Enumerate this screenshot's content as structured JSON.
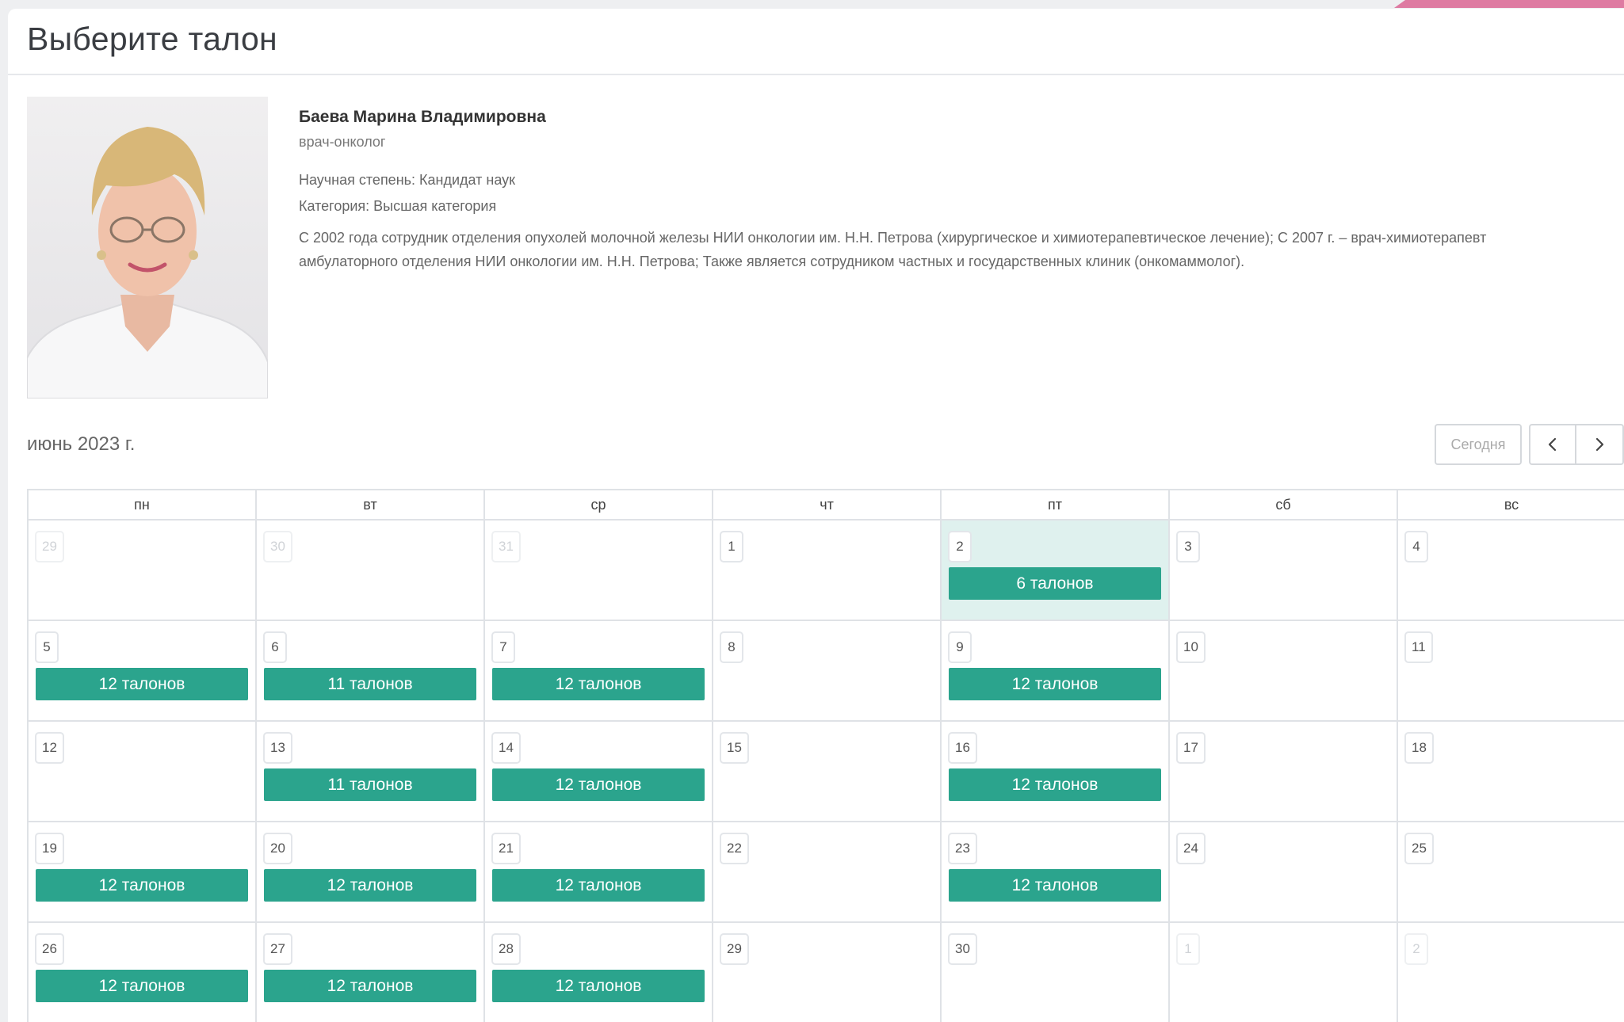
{
  "header": {
    "title": "Выберите талон"
  },
  "doctor": {
    "name": "Баева Марина Владимировна",
    "role": "врач-онколог",
    "degree": "Научная степень: Кандидат наук",
    "category": "Категория: Высшая категория",
    "bio": "С 2002 года сотрудник отделения опухолей молочной железы НИИ онкологии им. Н.Н. Петрова (хирургическое и химиотерапевтическое лечение); С 2007 г. – врач-химиотерапевт амбулаторного отделения НИИ онкологии им. Н.Н. Петрова; Также является сотрудником частных и государственных клиник (онкомаммолог)."
  },
  "calendar": {
    "month_label": "июнь 2023 г.",
    "today_label": "Сегодня",
    "weekdays": [
      "пн",
      "вт",
      "ср",
      "чт",
      "пт",
      "сб",
      "вс"
    ],
    "weeks": [
      [
        {
          "day": "29",
          "other": true
        },
        {
          "day": "30",
          "other": true
        },
        {
          "day": "31",
          "other": true
        },
        {
          "day": "1"
        },
        {
          "day": "2",
          "today": true,
          "slots": "6 талонов"
        },
        {
          "day": "3"
        },
        {
          "day": "4"
        }
      ],
      [
        {
          "day": "5",
          "slots": "12 талонов"
        },
        {
          "day": "6",
          "slots": "11 талонов"
        },
        {
          "day": "7",
          "slots": "12 талонов"
        },
        {
          "day": "8"
        },
        {
          "day": "9",
          "slots": "12 талонов"
        },
        {
          "day": "10"
        },
        {
          "day": "11"
        }
      ],
      [
        {
          "day": "12"
        },
        {
          "day": "13",
          "slots": "11 талонов"
        },
        {
          "day": "14",
          "slots": "12 талонов"
        },
        {
          "day": "15"
        },
        {
          "day": "16",
          "slots": "12 талонов"
        },
        {
          "day": "17"
        },
        {
          "day": "18"
        }
      ],
      [
        {
          "day": "19",
          "slots": "12 талонов"
        },
        {
          "day": "20",
          "slots": "12 талонов"
        },
        {
          "day": "21",
          "slots": "12 талонов"
        },
        {
          "day": "22"
        },
        {
          "day": "23",
          "slots": "12 талонов"
        },
        {
          "day": "24"
        },
        {
          "day": "25"
        }
      ],
      [
        {
          "day": "26",
          "slots": "12 талонов"
        },
        {
          "day": "27",
          "slots": "12 талонов"
        },
        {
          "day": "28",
          "slots": "12 талонов"
        },
        {
          "day": "29"
        },
        {
          "day": "30"
        },
        {
          "day": "1",
          "other": true
        },
        {
          "day": "2",
          "other": true
        }
      ]
    ]
  },
  "colors": {
    "accent": "#2ba48d",
    "today_bg": "#dff1ee",
    "top_accent": "#de7ba2"
  },
  "icons": {
    "prev": "chevron-left-icon",
    "next": "chevron-right-icon"
  }
}
